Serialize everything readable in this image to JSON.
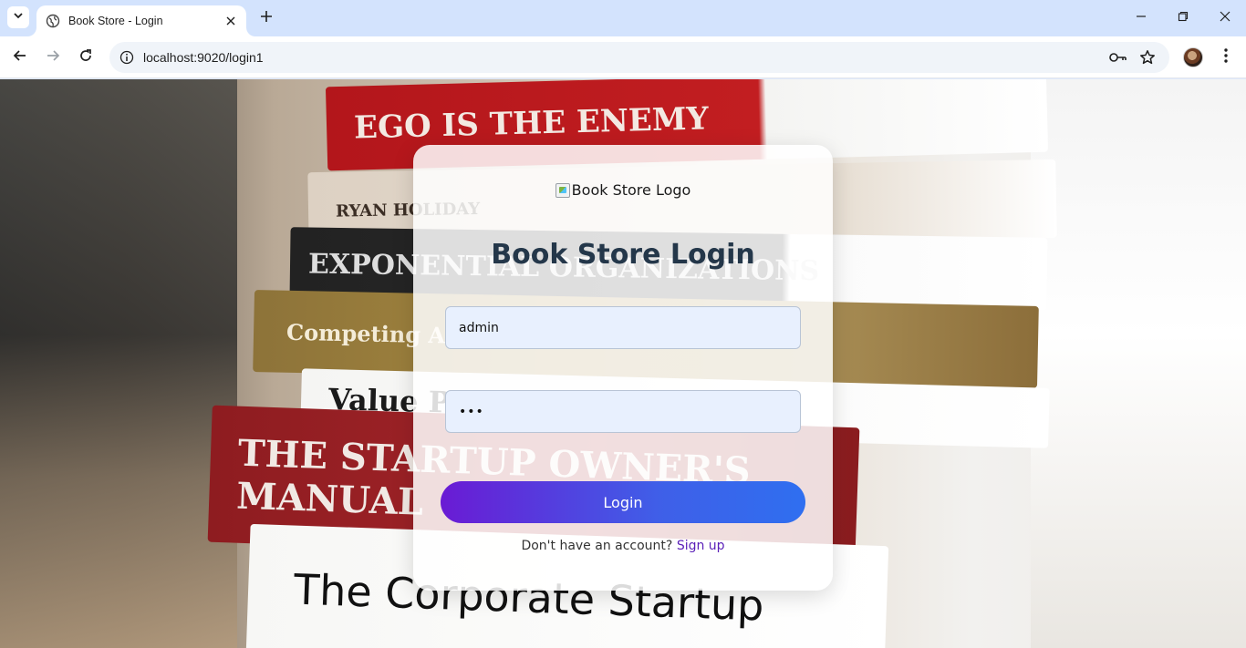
{
  "browser": {
    "tab_title": "Book Store - Login",
    "url": "localhost:9020/login1"
  },
  "background": {
    "books": [
      "EGO IS THE ENEMY",
      "RYAN HOLIDAY",
      "EXPONENTIAL ORGANIZATIONS",
      "Competing Against Luck",
      "Value Proposition Design",
      "THE STARTUP OWNER'S MANUAL",
      "The Corporate Startup"
    ]
  },
  "login": {
    "logo_alt": "Book Store Logo",
    "title": "Book Store Login",
    "username_value": "admin",
    "password_value": "•••",
    "login_button": "Login",
    "signup_prompt": "Don't have an account?",
    "signup_link": "Sign up"
  },
  "icons": {
    "tab_menu": "chevron-down-icon",
    "favicon": "globe-icon",
    "tab_close": "close-icon",
    "new_tab": "plus-icon",
    "minimize": "minimize-icon",
    "restore": "restore-icon",
    "close_window": "close-icon",
    "back": "arrow-left-icon",
    "forward": "arrow-right-icon",
    "reload": "reload-icon",
    "site_info": "info-icon",
    "password_key": "key-icon",
    "bookmark": "star-icon",
    "profile": "avatar",
    "menu": "kebab-menu-icon"
  }
}
